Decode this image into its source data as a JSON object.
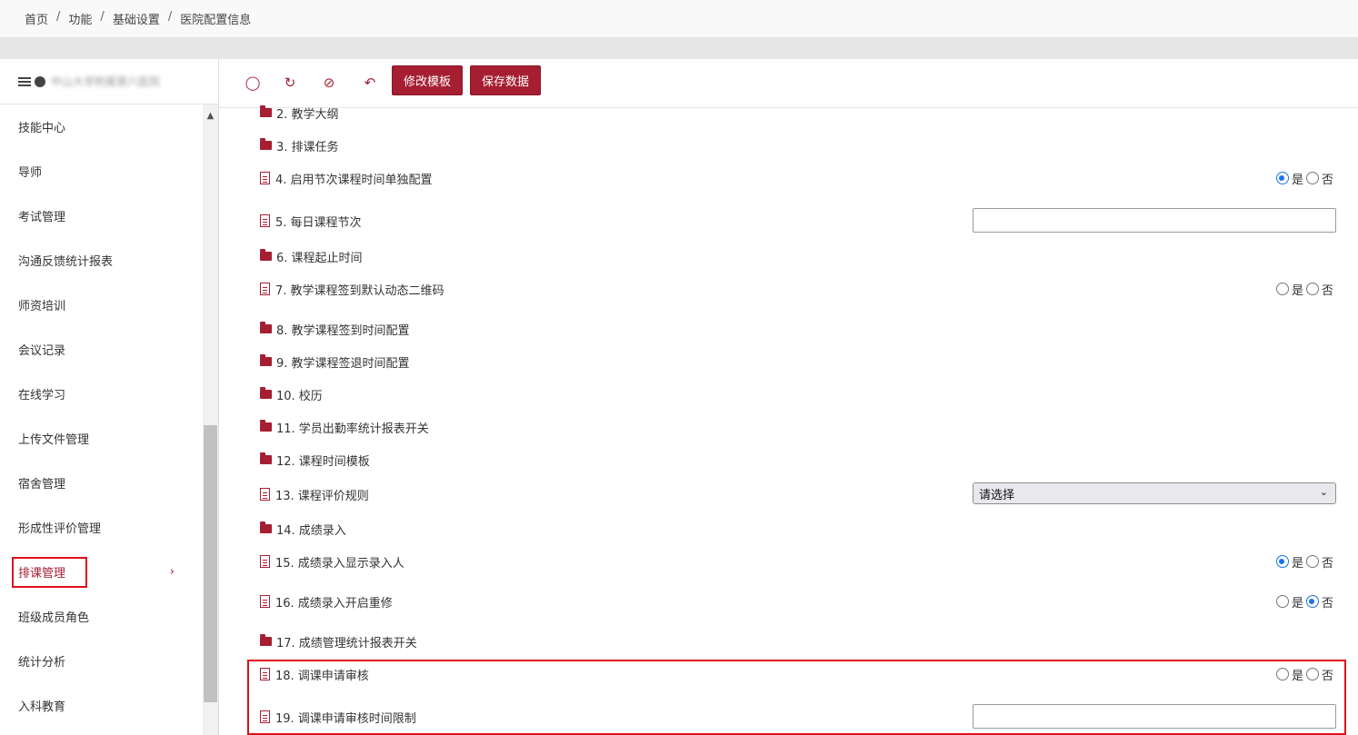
{
  "breadcrumb": [
    "首页",
    "功能",
    "基础设置",
    "医院配置信息"
  ],
  "sidebar": {
    "header_name": "中山大学附属第六医院",
    "items": [
      {
        "label": "技能中心"
      },
      {
        "label": "导师"
      },
      {
        "label": "考试管理"
      },
      {
        "label": "沟通反馈统计报表"
      },
      {
        "label": "师资培训"
      },
      {
        "label": "会议记录"
      },
      {
        "label": "在线学习"
      },
      {
        "label": "上传文件管理"
      },
      {
        "label": "宿舍管理"
      },
      {
        "label": "形成性评价管理"
      },
      {
        "label": "排课管理",
        "active": true
      },
      {
        "label": "班级成员角色"
      },
      {
        "label": "统计分析"
      },
      {
        "label": "入科教育"
      }
    ]
  },
  "toolbar": {
    "icons": [
      "lightbulb-icon",
      "refresh-icon",
      "eye-slash-icon",
      "undo-icon"
    ],
    "edit_template_label": "修改模板",
    "save_data_label": "保存数据"
  },
  "options": {
    "yes": "是",
    "no": "否"
  },
  "config_items": [
    {
      "label": "2. 教学大纲",
      "kind": "folder"
    },
    {
      "label": "3. 排课任务",
      "kind": "folder"
    },
    {
      "label": "4. 启用节次课程时间单独配置",
      "kind": "radio",
      "value": "是"
    },
    {
      "label": "5. 每日课程节次",
      "kind": "text",
      "value": ""
    },
    {
      "label": "6. 课程起止时间",
      "kind": "folder"
    },
    {
      "label": "7. 教学课程签到默认动态二维码",
      "kind": "radio",
      "value": ""
    },
    {
      "label": "8. 教学课程签到时间配置",
      "kind": "folder"
    },
    {
      "label": "9. 教学课程签退时间配置",
      "kind": "folder"
    },
    {
      "label": "10. 校历",
      "kind": "folder"
    },
    {
      "label": "11. 学员出勤率统计报表开关",
      "kind": "folder"
    },
    {
      "label": "12. 课程时间模板",
      "kind": "folder"
    },
    {
      "label": "13. 课程评价规则",
      "kind": "select",
      "value": "请选择"
    },
    {
      "label": "14. 成绩录入",
      "kind": "folder"
    },
    {
      "label": "15. 成绩录入显示录入人",
      "kind": "radio",
      "value": "是"
    },
    {
      "label": "16. 成绩录入开启重修",
      "kind": "radio",
      "value": "否"
    },
    {
      "label": "17. 成绩管理统计报表开关",
      "kind": "folder"
    },
    {
      "label": "18. 调课申请审核",
      "kind": "radio",
      "value": ""
    },
    {
      "label": "19. 调课申请审核时间限制",
      "kind": "text",
      "value": ""
    }
  ],
  "colors": {
    "accent": "#a51e32",
    "radio_selected": "#1a73e8",
    "highlight": "#e0101a"
  }
}
